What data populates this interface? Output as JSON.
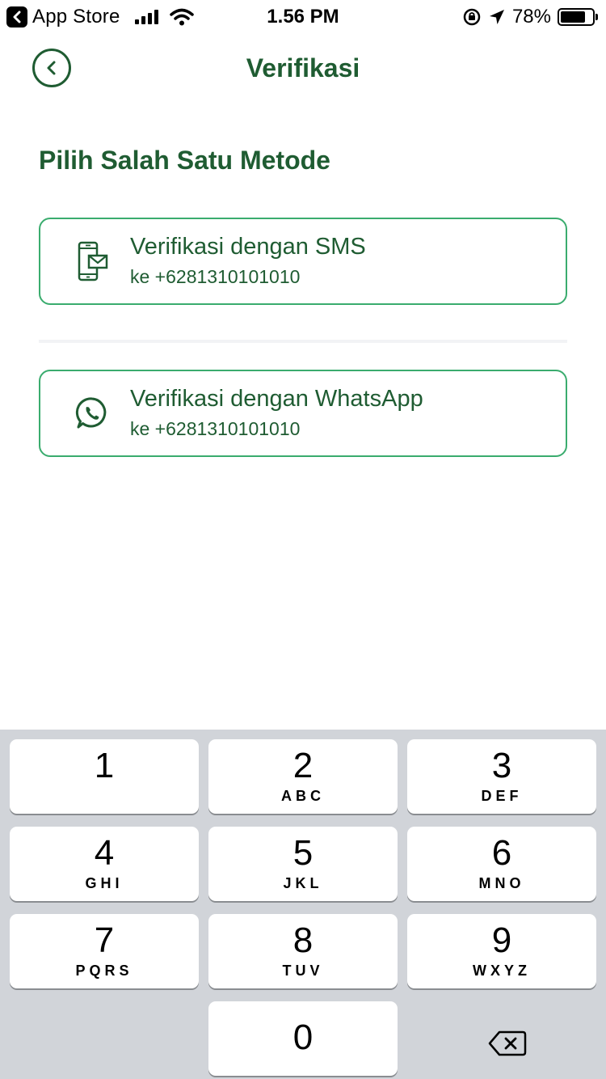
{
  "status_bar": {
    "back_app_label": "App Store",
    "time": "1.56 PM",
    "battery_percent_text": "78%",
    "battery_level": 0.78
  },
  "header": {
    "title": "Verifikasi",
    "back_icon": "chevron-left-icon"
  },
  "section_title": "Pilih Salah Satu Metode",
  "options": [
    {
      "label": "Verifikasi dengan SMS",
      "sub": "ke +6281310101010",
      "icon": "sms-phone-icon"
    },
    {
      "label": "Verifikasi dengan WhatsApp",
      "sub": "ke +6281310101010",
      "icon": "whatsapp-icon"
    }
  ],
  "keypad": {
    "keys": [
      {
        "num": "1",
        "letters": ""
      },
      {
        "num": "2",
        "letters": "ABC"
      },
      {
        "num": "3",
        "letters": "DEF"
      },
      {
        "num": "4",
        "letters": "GHI"
      },
      {
        "num": "5",
        "letters": "JKL"
      },
      {
        "num": "6",
        "letters": "MNO"
      },
      {
        "num": "7",
        "letters": "PQRS"
      },
      {
        "num": "8",
        "letters": "TUV"
      },
      {
        "num": "9",
        "letters": "WXYZ"
      },
      {
        "num": "0",
        "letters": ""
      }
    ],
    "delete_icon": "backspace-icon"
  },
  "colors": {
    "brand_green": "#1f5c32",
    "border_green": "#3aac6e",
    "keypad_bg": "#d1d4d9"
  }
}
